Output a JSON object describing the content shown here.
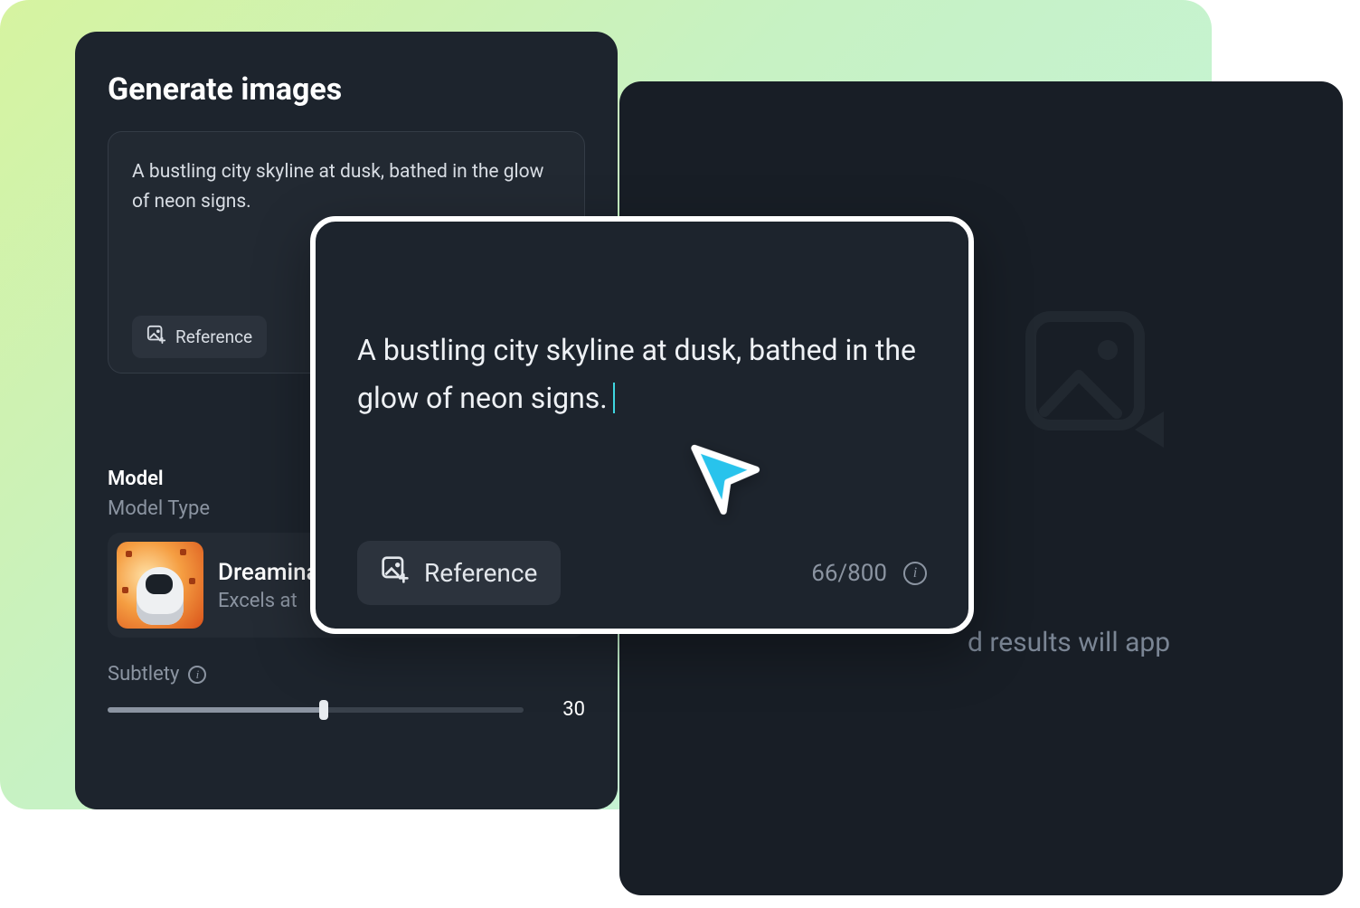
{
  "panel": {
    "title": "Generate images",
    "prompt_text": "A bustling city skyline at dusk, bathed in the glow of neon signs.",
    "reference_label": "Reference"
  },
  "model": {
    "section_label": "Model",
    "type_label": "Model Type",
    "name": "Dreamina",
    "desc": "Excels at",
    "subtlety_label": "Subtlety",
    "subtlety_value": "30"
  },
  "zoom": {
    "prompt_text": "A bustling city skyline at dusk, bathed in the glow of neon signs.",
    "reference_label": "Reference",
    "char_count": "66/800"
  },
  "results": {
    "placeholder_text": "d results will app"
  },
  "icons": {
    "reference": "reference-image-icon",
    "info": "info-icon",
    "gallery": "gallery-placeholder-icon",
    "cursor": "cursor-pointer-icon"
  }
}
